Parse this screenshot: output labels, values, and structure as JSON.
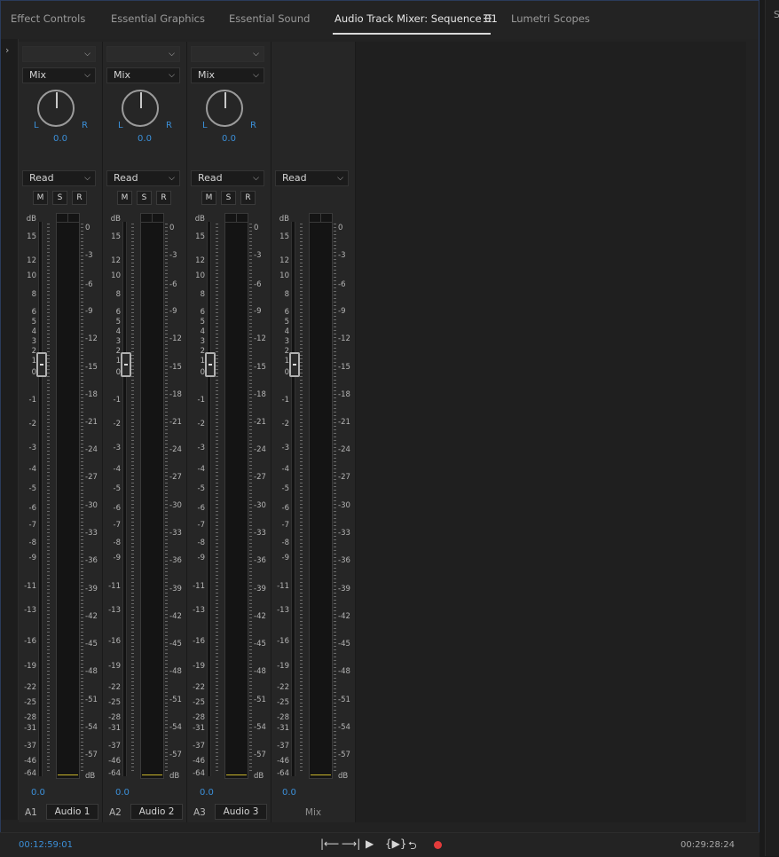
{
  "tabs": [
    {
      "label": "Effect Controls",
      "active": false
    },
    {
      "label": "Essential Graphics",
      "active": false
    },
    {
      "label": "Essential Sound",
      "active": false
    },
    {
      "label": "Audio Track Mixer: Sequence 01",
      "active": true
    },
    {
      "label": "Lumetri Scopes",
      "active": false
    }
  ],
  "right_strip_letter": "S",
  "channels": [
    {
      "effects_label": "Mix",
      "pan_left": "L",
      "pan_right": "R",
      "pan_value": "0.0",
      "automation": "Read",
      "mute": "M",
      "solo": "S",
      "record": "R",
      "db_label": "dB",
      "volume": "0.0",
      "track_id": "A1",
      "track_name": "Audio 1"
    },
    {
      "effects_label": "Mix",
      "pan_left": "L",
      "pan_right": "R",
      "pan_value": "0.0",
      "automation": "Read",
      "mute": "M",
      "solo": "S",
      "record": "R",
      "db_label": "dB",
      "volume": "0.0",
      "track_id": "A2",
      "track_name": "Audio 2"
    },
    {
      "effects_label": "Mix",
      "pan_left": "L",
      "pan_right": "R",
      "pan_value": "0.0",
      "automation": "Read",
      "mute": "M",
      "solo": "S",
      "record": "R",
      "db_label": "dB",
      "volume": "0.0",
      "track_id": "A3",
      "track_name": "Audio 3"
    }
  ],
  "master": {
    "automation": "Read",
    "db_label": "dB",
    "volume": "0.0",
    "label": "Mix"
  },
  "fader_scale": [
    "15",
    "12",
    "10",
    "8",
    "6",
    "5",
    "4",
    "3",
    "2",
    "1",
    "0",
    "-1",
    "-2",
    "-3",
    "-4",
    "-5",
    "-6",
    "-7",
    "-8",
    "-9",
    "-11",
    "-13",
    "-16",
    "-19",
    "-22",
    "-25",
    "-28",
    "-31",
    "-37",
    "-46",
    "-64"
  ],
  "meter_scale": [
    "0",
    "-3",
    "-6",
    "-9",
    "-12",
    "-15",
    "-18",
    "-21",
    "-24",
    "-27",
    "-30",
    "-33",
    "-36",
    "-39",
    "-42",
    "-45",
    "-48",
    "-51",
    "-54",
    "-57"
  ],
  "meter_unit": "dB",
  "timecode_current": "00:12:59:01",
  "timecode_duration": "00:29:28:24",
  "transport_icons": [
    "go-to-in-icon",
    "go-to-out-icon",
    "play-icon",
    "play-in-to-out-icon",
    "loop-icon",
    "record-icon"
  ],
  "colors": {
    "accent": "#3b8fd8",
    "record": "#e33b3b",
    "meter_level": "#c8b42a"
  }
}
